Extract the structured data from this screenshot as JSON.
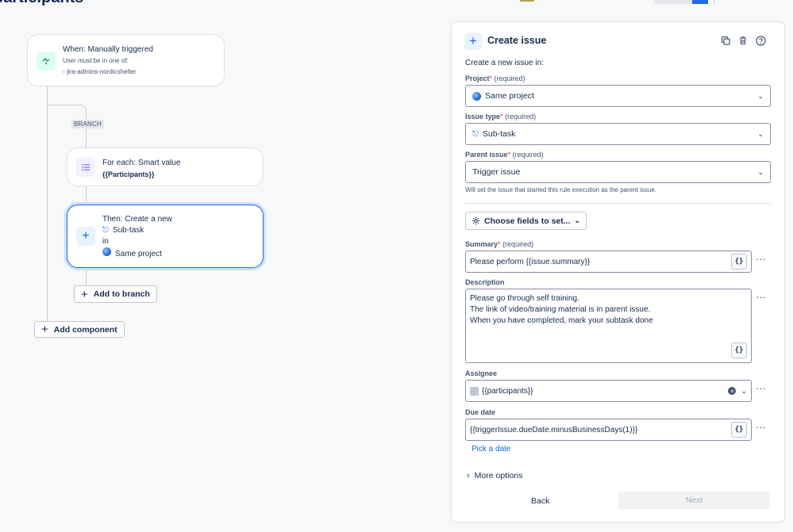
{
  "header": {
    "title": "participants"
  },
  "flow": {
    "trigger": {
      "title": "When: Manually triggered",
      "sub1": "User must be in one of:",
      "sub2": "jira-admins-nordicshelter"
    },
    "branch_tag": "BRANCH",
    "foreach": {
      "title": "For each: Smart value",
      "value": "{{Participants}}"
    },
    "action": {
      "line1": "Then: Create a new",
      "issue_type": "Sub-task",
      "in_label": "in",
      "project": "Same project"
    },
    "add_to_branch": "Add to branch",
    "add_component": "Add component"
  },
  "panel": {
    "title": "Create issue",
    "intro": "Create a new issue in:",
    "project": {
      "label": "Project",
      "required": "(required)",
      "value": "Same project"
    },
    "issue_type": {
      "label": "Issue type",
      "required": "(required)",
      "value": "Sub-task"
    },
    "parent_issue": {
      "label": "Parent issue",
      "required": "(required)",
      "value": "Trigger issue",
      "help": "Will set the issue that started this rule execution as the parent issue."
    },
    "choose_fields": "Choose fields to set...",
    "summary": {
      "label": "Summary",
      "required": "(required)",
      "value": "Please perform {{issue.summary}}"
    },
    "description": {
      "label": "Description",
      "lines": [
        "Please go through self training.",
        "The link of video/training material is in parent issue.",
        "When you have completed, mark your subtask done"
      ]
    },
    "assignee": {
      "label": "Assignee",
      "value": "{{participants}}"
    },
    "due_date": {
      "label": "Due date",
      "value": "{{triggerIssue.dueDate.minusBusinessDays(1)}}",
      "pick": "Pick a date"
    },
    "more_options": "More options",
    "back": "Back",
    "next": "Next"
  },
  "icons": {
    "trigger": "trigger-icon",
    "foreach": "list-icon",
    "action": "plus-icon",
    "copy": "copy-icon",
    "trash": "trash-icon",
    "help": "help-icon",
    "gear": "gear-icon"
  },
  "colors": {
    "accent": "#0c66e4",
    "selected_border": "#1d6ae5",
    "trigger_bg": "#dcfff1",
    "foreach_bg": "#f3f0ff"
  }
}
